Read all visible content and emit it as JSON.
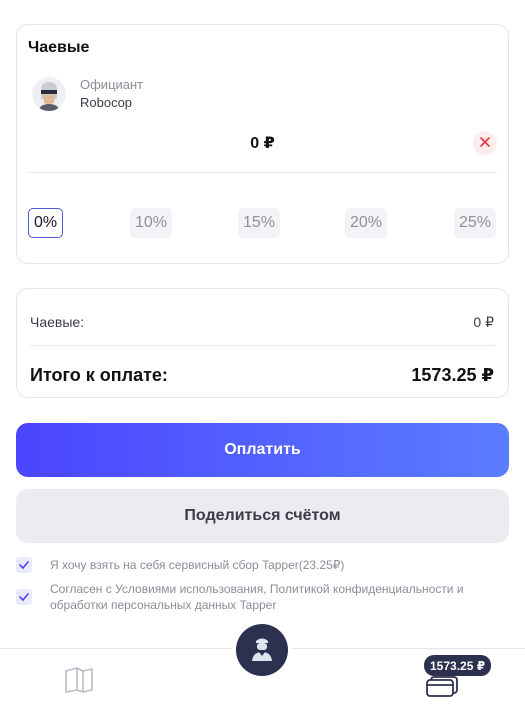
{
  "tips": {
    "title": "Чаевые",
    "waiter_role": "Официант",
    "waiter_name": "Robocop",
    "amount": "0 ₽",
    "percent_options": [
      "0%",
      "10%",
      "15%",
      "20%",
      "25%"
    ],
    "selected_percent": "0%"
  },
  "summary": {
    "tips_label": "Чаевые:",
    "tips_value": "0 ₽",
    "total_label": "Итого к оплате:",
    "total_value": "1573.25 ₽"
  },
  "actions": {
    "pay_label": "Оплатить",
    "share_label": "Поделиться счётом"
  },
  "agreements": [
    {
      "text": "Я хочу взять на себя сервисный сбор Tapper(23.25₽)",
      "checked": true
    },
    {
      "text": "Согласен с Условиями использования, Политикой конфиденциальности и обработки персональных данных Tapper",
      "checked": true
    }
  ],
  "bottom_nav": {
    "menu_icon": "book-icon",
    "center_icon": "waiter-icon",
    "bill_icon": "card-icon",
    "bill_badge": "1573.25 ₽"
  },
  "colors": {
    "accent_start": "#4b45ff",
    "accent_end": "#5b7dff",
    "dark": "#2c3150",
    "clear_icon": "#e53945"
  }
}
